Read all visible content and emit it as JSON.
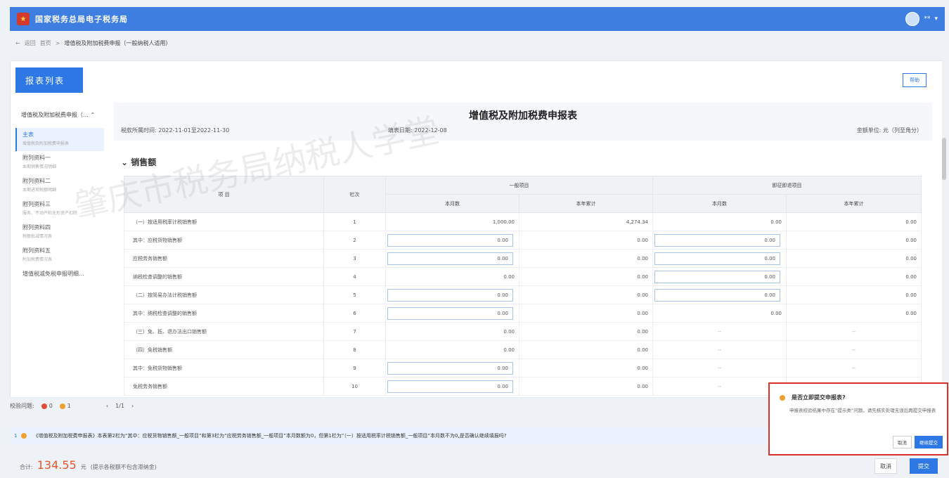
{
  "app": {
    "title": "国家税务总局电子税务局",
    "user": "**"
  },
  "breadcrumb": {
    "back": "返回",
    "home": "首页",
    "current": "增值税及附加税费申报（一般纳税人适用）"
  },
  "sidebar": {
    "button": "报表列表",
    "group": "增值税及附加税费申报（…",
    "items": [
      {
        "label": "主表",
        "sub": "增值税及附加税费申报表",
        "active": true
      },
      {
        "label": "附列资料一",
        "sub": "本期销售情况明细"
      },
      {
        "label": "附列资料二",
        "sub": "本期进项税额明细"
      },
      {
        "label": "附列资料三",
        "sub": "服务、不动产和无形资产扣除"
      },
      {
        "label": "附列资料四",
        "sub": "税额抵减情况表"
      },
      {
        "label": "附列资料五",
        "sub": "附加税费情况表"
      },
      {
        "label": "增值税减免税申报明细…",
        "sub": ""
      }
    ]
  },
  "toolbar": {
    "help": "帮助"
  },
  "form": {
    "title": "增值税及附加税费申报表",
    "period": "税款所属时间: 2022-11-01至2022-11-30",
    "fill_date": "填表日期: 2022-12-08",
    "unit": "金额单位: 元（列至角分）",
    "section": "销售额"
  },
  "table": {
    "h_item": "项  目",
    "h_col": "栏次",
    "h_general": "一般项目",
    "h_refund": "即征即退项目",
    "h_month": "本月数",
    "h_ytd": "本年累计",
    "rows": [
      {
        "item": "（一）按适用税率计税销售额",
        "col": "1",
        "a": "1,000.00",
        "b": "4,274.34",
        "c": "0.00",
        "d": "0.00",
        "ia": false,
        "ic": false
      },
      {
        "item": "其中：应税货物销售额",
        "col": "2",
        "a": "0.00",
        "b": "0.00",
        "c": "0.00",
        "d": "0.00",
        "ia": true,
        "ic": true
      },
      {
        "item": "应税劳务销售额",
        "col": "3",
        "a": "0.00",
        "b": "0.00",
        "c": "0.00",
        "d": "0.00",
        "ia": true,
        "ic": true
      },
      {
        "item": "纳税检查调整的销售额",
        "col": "4",
        "a": "0.00",
        "b": "0.00",
        "c": "0.00",
        "d": "0.00",
        "ia": false,
        "ic": true
      },
      {
        "item": "（二）按简易办法计税销售额",
        "col": "5",
        "a": "0.00",
        "b": "0.00",
        "c": "0.00",
        "d": "0.00",
        "ia": true,
        "ic": true
      },
      {
        "item": "其中：纳税检查调整的销售额",
        "col": "6",
        "a": "0.00",
        "b": "0.00",
        "c": "0.00",
        "d": "0.00",
        "ia": true,
        "ic": false
      },
      {
        "item": "（三）免、抵、退办法出口销售额",
        "col": "7",
        "a": "0.00",
        "b": "0.00",
        "c": "--",
        "d": "--",
        "ia": false,
        "ic": false
      },
      {
        "item": "（四）免税销售额",
        "col": "8",
        "a": "0.00",
        "b": "0.00",
        "c": "--",
        "d": "--",
        "ia": false,
        "ic": false
      },
      {
        "item": "其中：免税货物销售额",
        "col": "9",
        "a": "0.00",
        "b": "0.00",
        "c": "--",
        "d": "--",
        "ia": true,
        "ic": false
      },
      {
        "item": "免税劳务销售额",
        "col": "10",
        "a": "0.00",
        "b": "0.00",
        "c": "--",
        "d": "--",
        "ia": true,
        "ic": false
      }
    ]
  },
  "check": {
    "label": "校验问题:",
    "red": "0",
    "orange": "1",
    "pager": "1/1"
  },
  "tip": {
    "index": "1",
    "text": "《增值税及附加税费申报表》本表第2栏为“其中：应税货物销售额_一般项目”和第3栏为“应税劳务销售额_一般项目”本月数额为0，但第1栏为“（一）按适用税率计税销售额_一般项目”本月数不为0,是否确认继续填报吗?"
  },
  "total": {
    "label": "合计:",
    "amount": "134.55",
    "unit": "元",
    "note": "(提示各税额不包含滞纳金)"
  },
  "footer": {
    "cancel": "取消",
    "submit": "提交"
  },
  "popup": {
    "title": "是否立即提交申报表?",
    "body": "申报表校验结果中存在“提示类”问题，请先核实处理无误后再提交申报表",
    "cancel": "取消",
    "confirm": "继续提交"
  },
  "watermark": {
    "text": "肇庆市税务局纳税人学堂"
  },
  "colors": {
    "primary": "#2e78e6",
    "topbar": "#3d7ee0",
    "alert": "#d8322a",
    "amount": "#e4572e"
  }
}
